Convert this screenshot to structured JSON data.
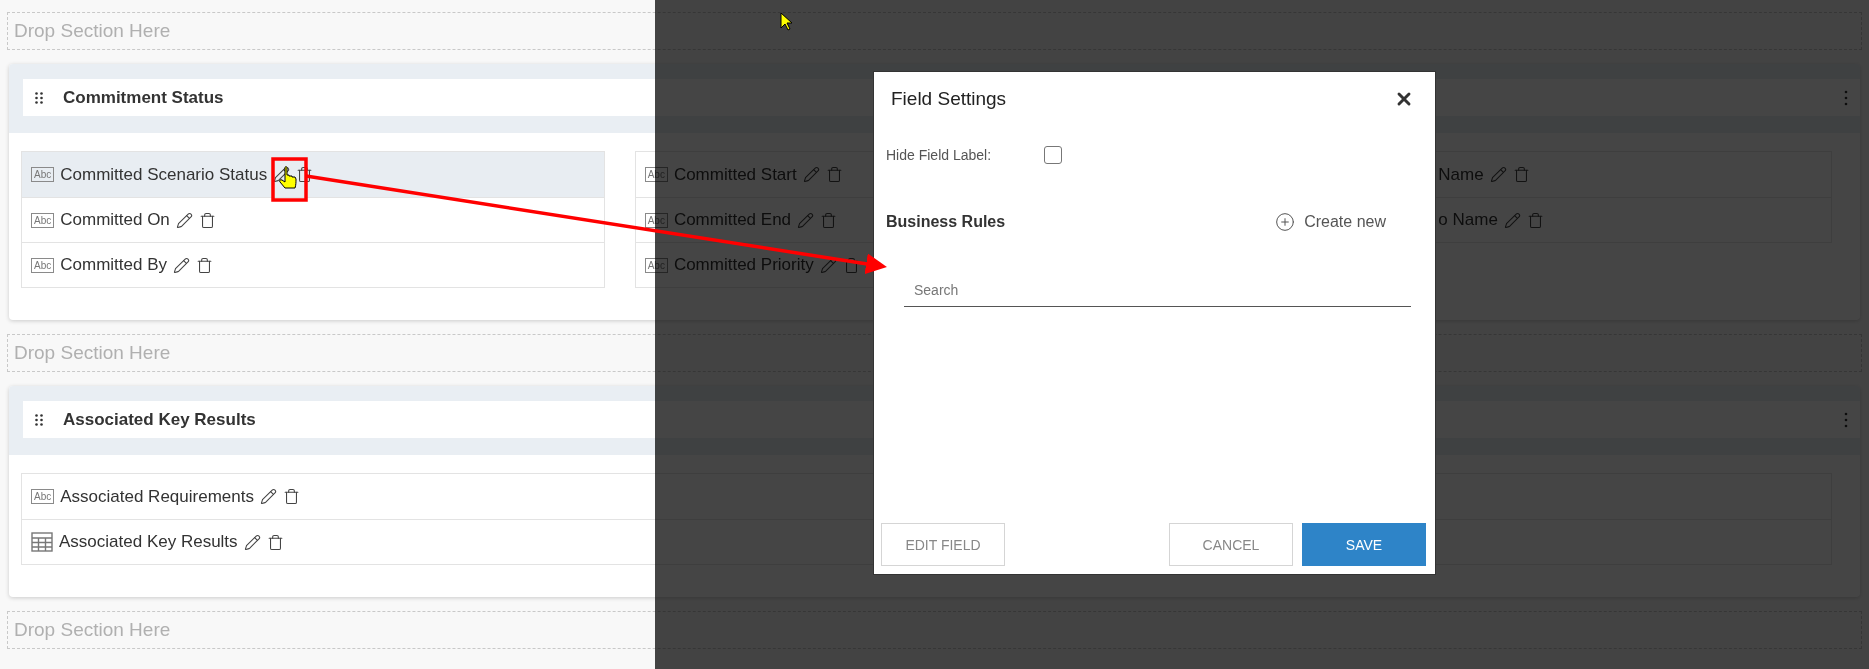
{
  "layout": [
    {
      "kind": "drop_zone",
      "label": "Drop Section Here"
    },
    {
      "kind": "section",
      "title": "Commitment Status",
      "columns": [
        {
          "fields": [
            {
              "kind": "text",
              "badge": "Abc",
              "label": "Committed Scenario Status",
              "selected": true
            },
            {
              "kind": "text",
              "badge": "Abc",
              "label": "Committed On",
              "selected": false
            },
            {
              "kind": "text",
              "badge": "Abc",
              "label": "Committed By",
              "selected": false
            }
          ]
        },
        {
          "fields": [
            {
              "kind": "text",
              "badge": "Abc",
              "label": "Committed Start",
              "selected": false
            },
            {
              "kind": "text",
              "badge": "Abc",
              "label": "Committed End",
              "selected": false
            },
            {
              "kind": "text",
              "badge": "Abc",
              "label": "Committed Priority",
              "selected": false
            }
          ]
        },
        {
          "hidden_start": true,
          "fields": [
            {
              "kind": "text",
              "label": "Name"
            },
            {
              "kind": "text",
              "label": "o Name"
            }
          ]
        }
      ]
    },
    {
      "kind": "drop_zone",
      "label": "Drop Section Here"
    },
    {
      "kind": "section",
      "title": "Associated Key Results",
      "columns": [
        {
          "fields": [
            {
              "kind": "text",
              "badge": "Abc",
              "label": "Associated Requirements",
              "selected": false
            },
            {
              "kind": "grid",
              "label": "Associated Key Results",
              "selected": false
            }
          ]
        }
      ]
    },
    {
      "kind": "drop_zone",
      "label": "Drop Section Here"
    }
  ],
  "modal": {
    "title": "Field Settings",
    "hide_label": {
      "label": "Hide Field Label:",
      "checked": false
    },
    "rules_title": "Business Rules",
    "create_label": "Create new",
    "search": {
      "placeholder": "Search"
    },
    "buttons_left": [
      {
        "label": "EDIT FIELD",
        "kind": "outline"
      }
    ],
    "buttons_right": [
      {
        "label": "CANCEL",
        "kind": "outline"
      },
      {
        "label": "SAVE",
        "kind": "primary"
      }
    ]
  }
}
